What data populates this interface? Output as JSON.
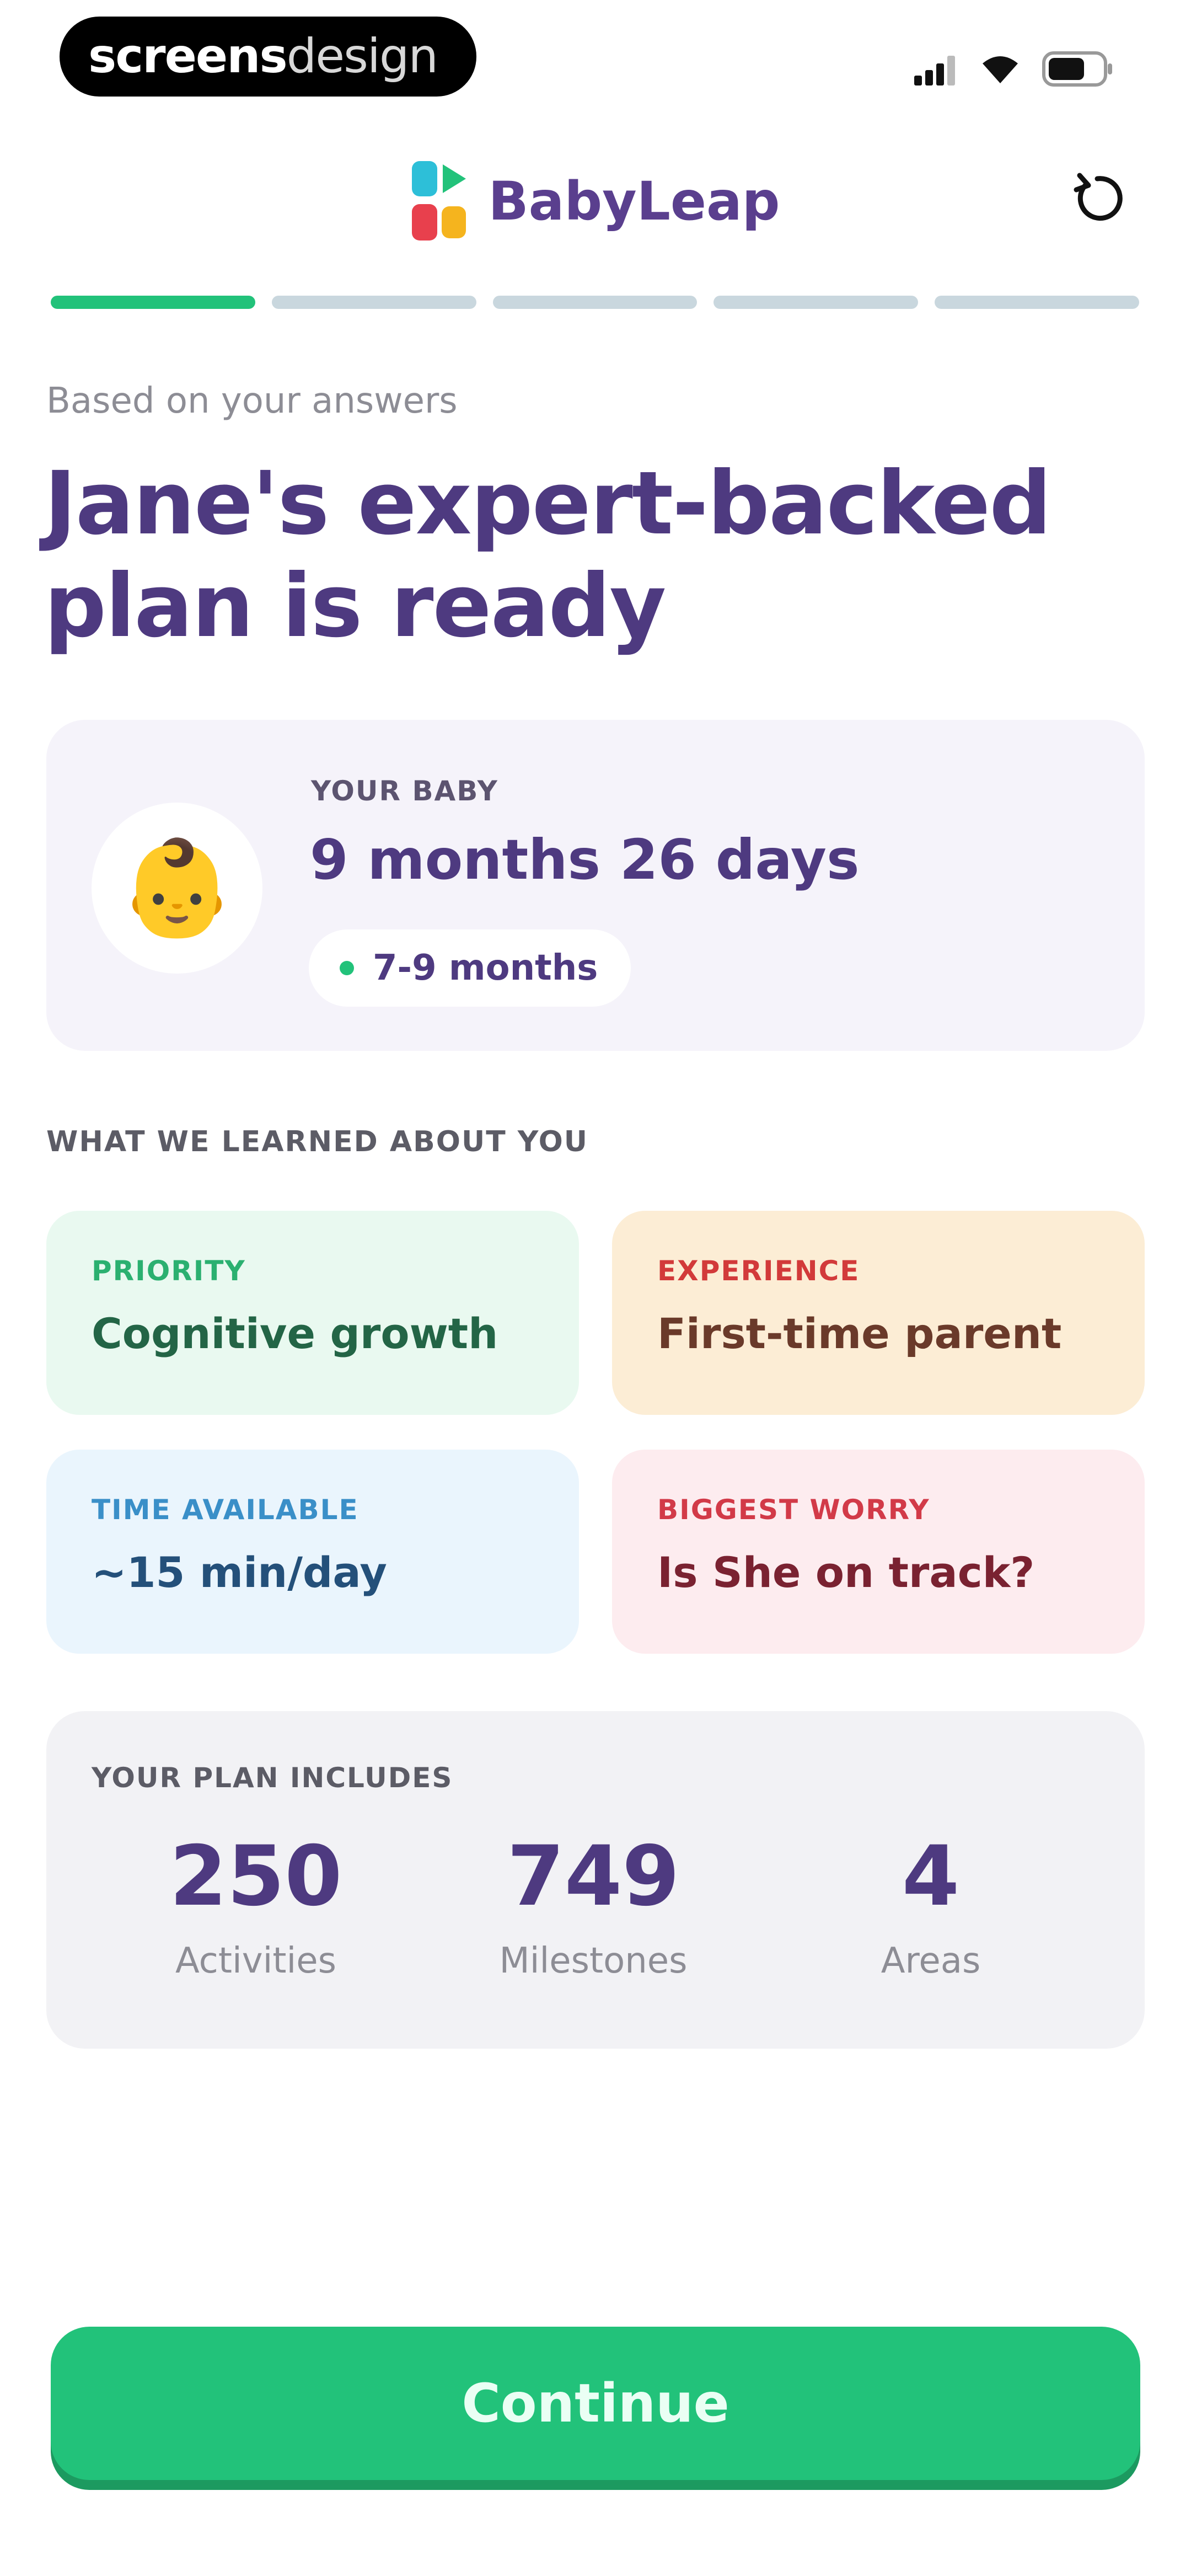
{
  "status_bar": {
    "watermark_bold": "screens",
    "watermark_thin": "design",
    "icons": [
      "signal-icon",
      "wifi-icon",
      "battery-icon"
    ]
  },
  "header": {
    "brand_name": "BabyLeap",
    "logo_colors": [
      "#2dbfd8",
      "#22c27a",
      "#e8404d",
      "#f5b41e"
    ],
    "restart_icon": "restart-icon"
  },
  "progress": {
    "total_steps": 5,
    "current_step": 1,
    "active_color": "#22c27a",
    "inactive_color": "#c9d7de"
  },
  "intro": {
    "subtitle": "Based on your answers",
    "title": "Jane's expert-backed plan is ready"
  },
  "baby": {
    "label": "YOUR BABY",
    "age": "9 months 26 days",
    "range": "7-9 months",
    "avatar": "👶"
  },
  "learned": {
    "section_label": "WHAT WE LEARNED ABOUT YOU",
    "cards": [
      {
        "label": "PRIORITY",
        "value": "Cognitive growth"
      },
      {
        "label": "EXPERIENCE",
        "value": "First-time parent"
      },
      {
        "label": "TIME AVAILABLE",
        "value": "~15 min/day"
      },
      {
        "label": "BIGGEST WORRY",
        "value": "Is She on track?"
      }
    ]
  },
  "plan": {
    "label": "YOUR PLAN INCLUDES",
    "stats": [
      {
        "value": "250",
        "caption": "Activities"
      },
      {
        "value": "749",
        "caption": "Milestones"
      },
      {
        "value": "4",
        "caption": "Areas"
      }
    ]
  },
  "cta": {
    "label": "Continue",
    "color": "#22c27a"
  }
}
